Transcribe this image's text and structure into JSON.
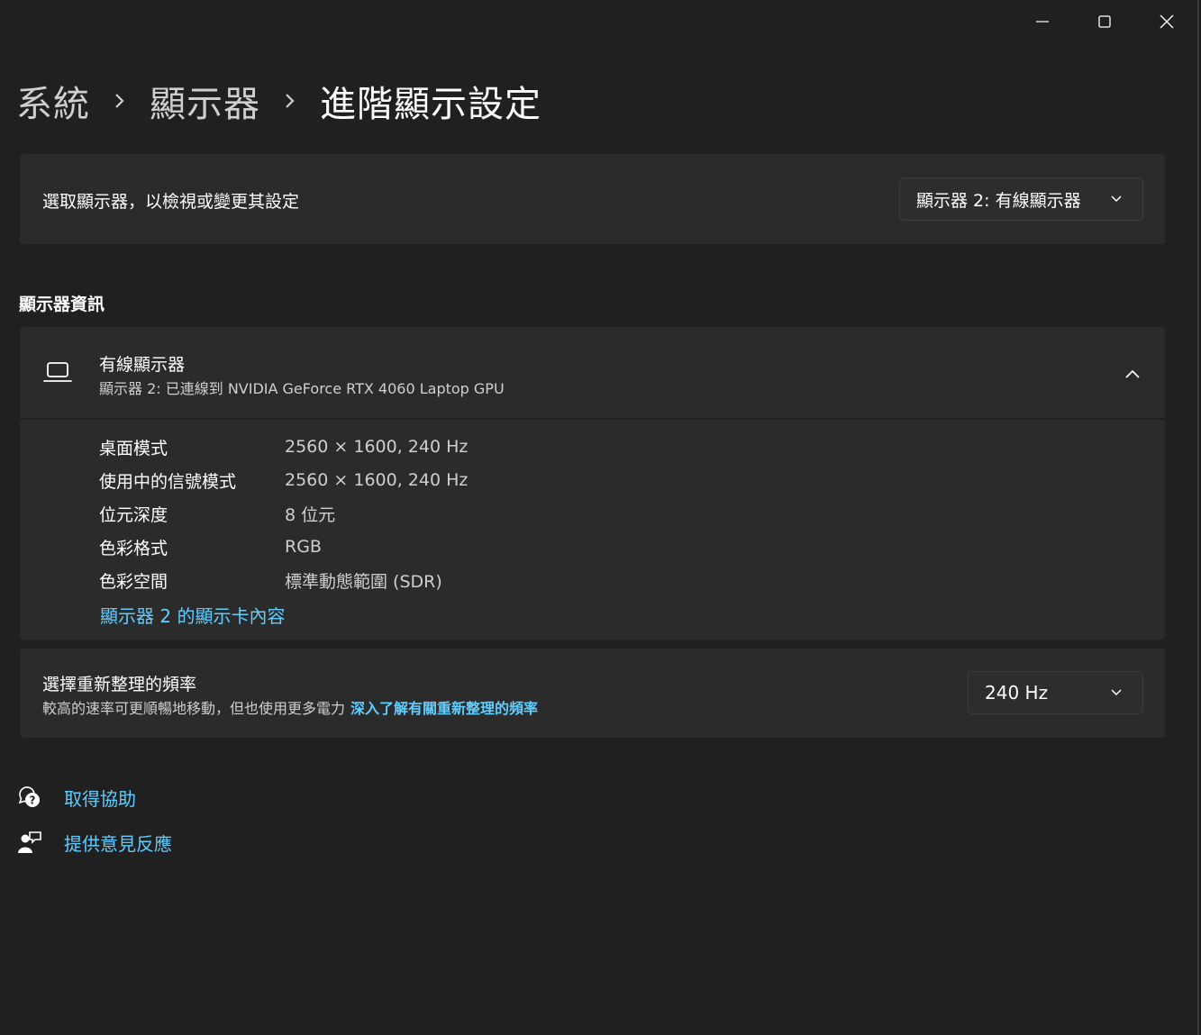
{
  "window": {
    "controls": [
      "minimize",
      "maximize",
      "close"
    ]
  },
  "breadcrumb": {
    "items": [
      "系統",
      "顯示器",
      "進階顯示設定"
    ]
  },
  "monitor_select": {
    "label": "選取顯示器，以檢視或變更其設定",
    "selected": "顯示器 2: 有線顯示器"
  },
  "display_info": {
    "section_title": "顯示器資訊",
    "name": "有線顯示器",
    "connection": "顯示器 2: 已連線到 NVIDIA GeForce RTX 4060 Laptop GPU",
    "specs": [
      {
        "label": "桌面模式",
        "value": "2560 × 1600, 240 Hz"
      },
      {
        "label": "使用中的信號模式",
        "value": "2560 × 1600, 240 Hz"
      },
      {
        "label": "位元深度",
        "value": "8 位元"
      },
      {
        "label": "色彩格式",
        "value": "RGB"
      },
      {
        "label": "色彩空間",
        "value": "標準動態範圍 (SDR)"
      }
    ],
    "adapter_link": "顯示器 2 的顯示卡內容"
  },
  "refresh_rate": {
    "title": "選擇重新整理的頻率",
    "description": "較高的速率可更順暢地移動，但也使用更多電力",
    "learn_more": "深入了解有關重新整理的頻率",
    "selected": "240 Hz"
  },
  "help": {
    "get_help": "取得協助",
    "feedback": "提供意見反應"
  },
  "colors": {
    "background": "#202020",
    "card": "#2b2b2b",
    "accent_link": "#60cdff",
    "text_secondary": "#cfcfcf"
  },
  "icons": {
    "laptop": "laptop-icon",
    "chevron_up": "chevron-up-icon",
    "chevron_down": "chevron-down-icon",
    "help": "help-chat-icon",
    "feedback": "feedback-icon"
  }
}
